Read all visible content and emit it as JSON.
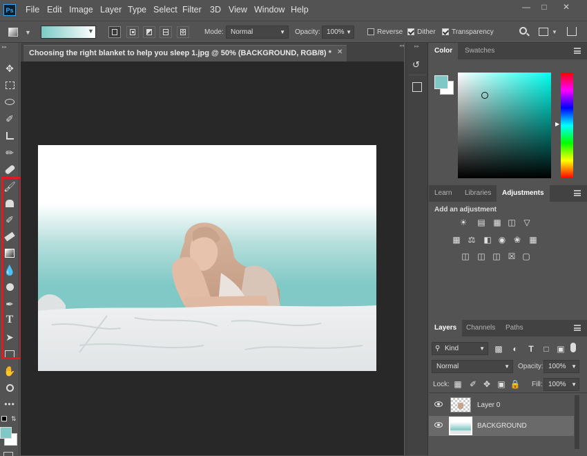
{
  "menu": {
    "logo": "Ps",
    "items": [
      "File",
      "Edit",
      "Image",
      "Layer",
      "Type",
      "Select",
      "Filter",
      "3D",
      "View",
      "Window",
      "Help"
    ]
  },
  "options": {
    "mode_label": "Mode:",
    "mode_value": "Normal",
    "opacity_label": "Opacity:",
    "opacity_value": "100%",
    "reverse_label": "Reverse",
    "dither_label": "Dither",
    "transparency_label": "Transparency",
    "reverse_checked": false,
    "dither_checked": true,
    "transparency_checked": true
  },
  "document": {
    "tab_title": "Choosing the right blanket to help you sleep 1.jpg @ 50% (BACKGROUND, RGB/8) *"
  },
  "color_panel": {
    "tabs": [
      "Color",
      "Swatches"
    ],
    "foreground": "#7fc8c6",
    "picker_hue": "#00ffee"
  },
  "adjust_panel": {
    "tabs": [
      "Learn",
      "Libraries",
      "Adjustments"
    ],
    "heading": "Add an adjustment"
  },
  "layers_panel": {
    "tabs": [
      "Layers",
      "Channels",
      "Paths"
    ],
    "kind_label": "Kind",
    "blend_mode": "Normal",
    "opacity_label": "Opacity:",
    "opacity_value": "100%",
    "lock_label": "Lock:",
    "fill_label": "Fill:",
    "fill_value": "100%",
    "layers": [
      {
        "name": "Layer 0"
      },
      {
        "name": "BACKGROUND"
      }
    ]
  },
  "colors": {
    "accent_highlight": "#e01b24",
    "teal": "#7ccac6"
  }
}
